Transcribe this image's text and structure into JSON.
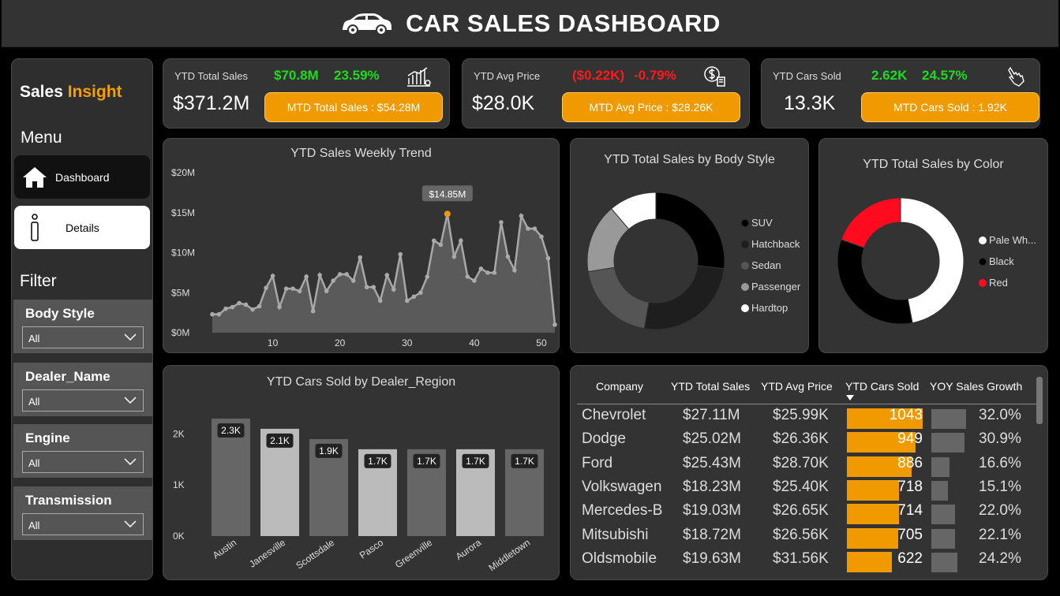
{
  "header": {
    "title": "CAR SALES DASHBOARD"
  },
  "sidebar": {
    "brand_white": "Sales ",
    "brand_orange": "Insight",
    "menu_title": "Menu",
    "nav": [
      {
        "label": "Dashboard",
        "icon": "home-icon",
        "active": true
      },
      {
        "label": "Details",
        "icon": "info-icon",
        "active": false
      }
    ],
    "filter_title": "Filter",
    "slicers": [
      {
        "label": "Body Style",
        "value": "All"
      },
      {
        "label": "Dealer_Name",
        "value": "All"
      },
      {
        "label": "Engine",
        "value": "All"
      },
      {
        "label": "Transmission",
        "value": "All"
      }
    ]
  },
  "kpis": [
    {
      "label": "YTD Total Sales",
      "value": "$371.2M",
      "change_abs": "$70.8M",
      "change_pct": "23.59%",
      "direction": "up",
      "mtd": "MTD Total Sales : $54.28M",
      "icon": "bar-chart-icon"
    },
    {
      "label": "YTD Avg Price",
      "value": "$28.0K",
      "change_abs": "($0.22K)",
      "change_pct": "-0.79%",
      "direction": "down",
      "mtd": "MTD Avg Price : $28.26K",
      "icon": "money-icon"
    },
    {
      "label": "YTD Cars Sold",
      "value": "13.3K",
      "change_abs": "2.62K",
      "change_pct": "24.57%",
      "direction": "up",
      "mtd": "MTD Cars Sold : 1.92K",
      "icon": "hand-pointer-icon"
    }
  ],
  "weekly": {
    "title": "YTD Sales Weekly Trend",
    "tooltip": "$14.85M",
    "y_ticks": [
      "$20M",
      "$15M",
      "$10M",
      "$5M",
      "$0M"
    ],
    "x_ticks": [
      "10",
      "20",
      "30",
      "40",
      "50"
    ]
  },
  "body_style": {
    "title": "YTD Total Sales by Body Style",
    "legend": [
      "SUV",
      "Hatchback",
      "Sedan",
      "Passenger",
      "Hardtop"
    ]
  },
  "color_chart": {
    "title": "YTD Total Sales by Color",
    "legend": [
      "Pale Wh...",
      "Black",
      "Red"
    ]
  },
  "region": {
    "title": "YTD Cars Sold by Dealer_Region",
    "y_ticks": [
      "2K",
      "1K",
      "0K"
    ]
  },
  "table": {
    "headers": [
      "Company",
      "YTD Total Sales",
      "YTD Avg Price",
      "YTD Cars Sold",
      "YOY Sales Growth"
    ],
    "rows": [
      {
        "company": "Chevrolet",
        "sales": "$27.11M",
        "avg": "$25.99K",
        "sold": "1043",
        "sold_n": 1043,
        "growth": "32.0%",
        "growth_n": 32.0
      },
      {
        "company": "Dodge",
        "sales": "$25.02M",
        "avg": "$26.36K",
        "sold": "949",
        "sold_n": 949,
        "growth": "30.9%",
        "growth_n": 30.9
      },
      {
        "company": "Ford",
        "sales": "$25.43M",
        "avg": "$28.70K",
        "sold": "886",
        "sold_n": 886,
        "growth": "16.6%",
        "growth_n": 16.6
      },
      {
        "company": "Volkswagen",
        "sales": "$18.23M",
        "avg": "$25.40K",
        "sold": "718",
        "sold_n": 718,
        "growth": "15.1%",
        "growth_n": 15.1
      },
      {
        "company": "Mercedes-B",
        "sales": "$19.03M",
        "avg": "$26.65K",
        "sold": "714",
        "sold_n": 714,
        "growth": "22.0%",
        "growth_n": 22.0
      },
      {
        "company": "Mitsubishi",
        "sales": "$18.72M",
        "avg": "$26.56K",
        "sold": "705",
        "sold_n": 705,
        "growth": "22.1%",
        "growth_n": 22.1
      },
      {
        "company": "Oldsmobile",
        "sales": "$19.63M",
        "avg": "$31.56K",
        "sold": "622",
        "sold_n": 622,
        "growth": "24.2%",
        "growth_n": 24.2
      }
    ]
  },
  "colors": {
    "accent": "#f19a00",
    "positive": "#1edb1e",
    "negative": "#ff1a1a",
    "panel": "#333333",
    "red": "#ff0a1e"
  },
  "chart_data": [
    {
      "type": "area",
      "title": "YTD Sales Weekly Trend",
      "x": [
        1,
        2,
        3,
        4,
        5,
        6,
        7,
        8,
        9,
        10,
        11,
        12,
        13,
        14,
        15,
        16,
        17,
        18,
        19,
        20,
        21,
        22,
        23,
        24,
        25,
        26,
        27,
        28,
        29,
        30,
        31,
        32,
        33,
        34,
        35,
        36,
        37,
        38,
        39,
        40,
        41,
        42,
        43,
        44,
        45,
        46,
        47,
        48,
        49,
        50,
        51,
        52
      ],
      "values": [
        2.3,
        2.3,
        3.0,
        3.2,
        3.7,
        3.5,
        2.9,
        3.3,
        5.6,
        7.1,
        3.2,
        5.5,
        5.5,
        5.2,
        7.0,
        2.7,
        7.2,
        5.2,
        6.5,
        7.3,
        7.3,
        6.5,
        9.4,
        5.7,
        5.7,
        4.0,
        7.2,
        5.4,
        9.8,
        4.0,
        4.5,
        5.0,
        7.0,
        11.5,
        11.0,
        14.85,
        9.5,
        11.5,
        7.0,
        6.5,
        8.0,
        7.5,
        7.5,
        13.8,
        9.5,
        7.8,
        14.6,
        13.0,
        13.0,
        12.0,
        9.3,
        1.0
      ],
      "xlabel": "",
      "ylabel": "",
      "ylim": [
        0,
        20
      ],
      "x_ticks": [
        10,
        20,
        30,
        40,
        50
      ],
      "y_ticks": [
        "$0M",
        "$5M",
        "$10M",
        "$15M",
        "$20M"
      ],
      "grid": false
    },
    {
      "type": "pie",
      "title": "YTD Total Sales by Body Style",
      "categories": [
        "SUV",
        "Hatchback",
        "Sedan",
        "Passenger",
        "Hardtop"
      ],
      "values": [
        26.8,
        25.9,
        19.8,
        16.3,
        11.2
      ],
      "colors": [
        "#000000",
        "#1e1e1e",
        "#555555",
        "#999999",
        "#ffffff"
      ],
      "legend": "right"
    },
    {
      "type": "pie",
      "title": "YTD Total Sales by Color",
      "categories": [
        "Pale White",
        "Black",
        "Red"
      ],
      "values": [
        47.0,
        33.5,
        19.5
      ],
      "colors": [
        "#ffffff",
        "#000000",
        "#ff0a1e"
      ],
      "legend": "right"
    },
    {
      "type": "bar",
      "title": "YTD Cars Sold by Dealer_Region",
      "categories": [
        "Austin",
        "Janesville",
        "Scottsdale",
        "Pasco",
        "Greenville",
        "Aurora",
        "Middletown"
      ],
      "values": [
        2.3,
        2.1,
        1.9,
        1.7,
        1.7,
        1.7,
        1.7
      ],
      "labels": [
        "2.3K",
        "2.1K",
        "1.9K",
        "1.7K",
        "1.7K",
        "1.7K",
        "1.7K"
      ],
      "ylim": [
        0,
        2.5
      ],
      "y_ticks": [
        "0K",
        "1K",
        "2K"
      ]
    }
  ]
}
